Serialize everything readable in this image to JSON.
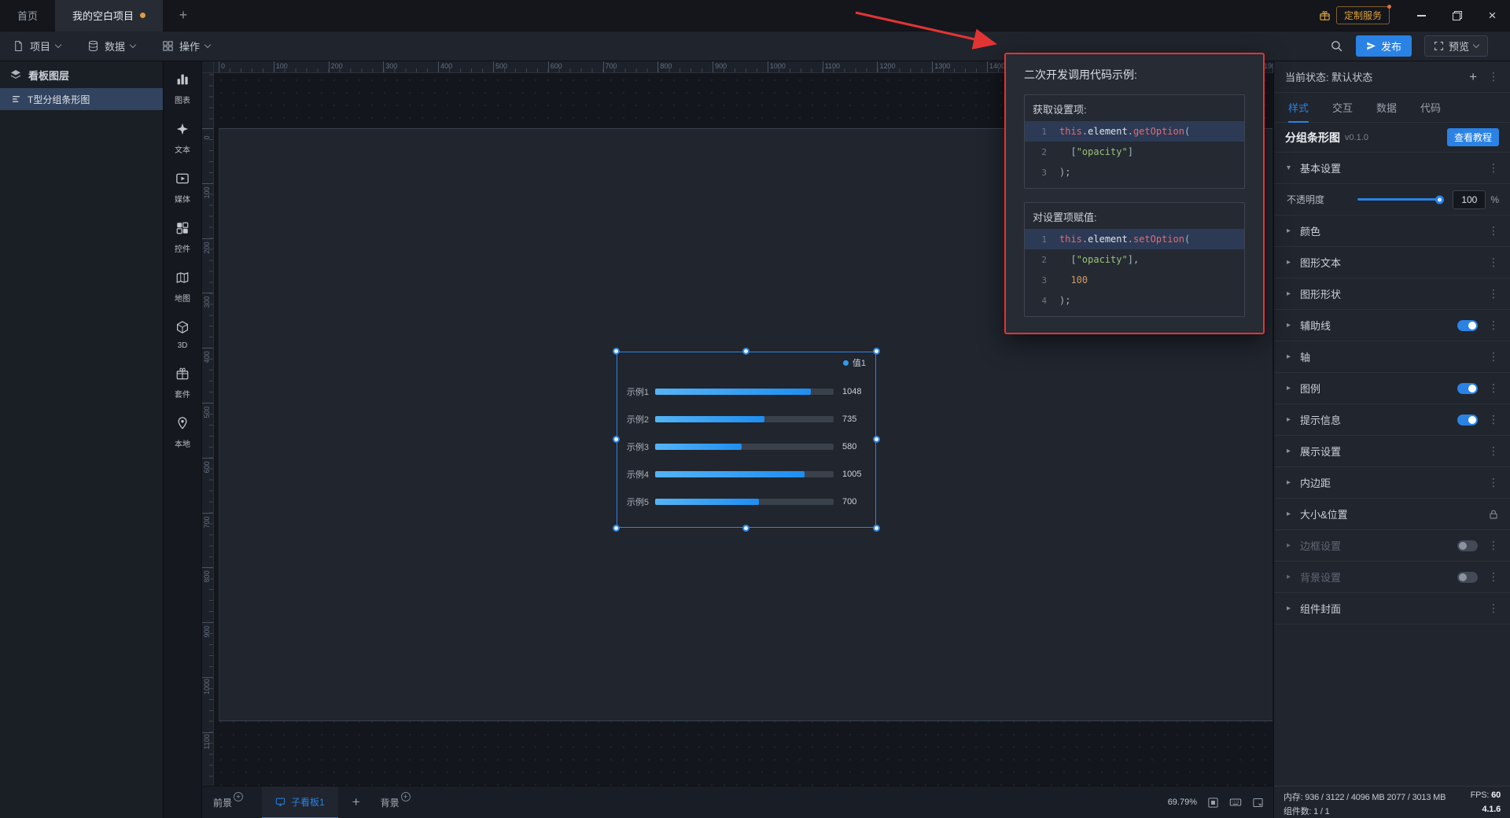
{
  "titlebar": {
    "home_tab": "首页",
    "project_tab": "我的空白项目",
    "custom_service": "定制服务"
  },
  "menubar": {
    "project": "项目",
    "data": "数据",
    "operation": "操作",
    "publish": "发布",
    "preview": "预览"
  },
  "layers_panel": {
    "title": "看板图层",
    "items": [
      {
        "label": "T型分组条形图",
        "selected": true
      }
    ]
  },
  "component_bar": {
    "items": [
      {
        "label": "图表",
        "icon": "chart-icon"
      },
      {
        "label": "文本",
        "icon": "text-icon"
      },
      {
        "label": "媒体",
        "icon": "media-icon"
      },
      {
        "label": "控件",
        "icon": "widget-icon"
      },
      {
        "label": "地图",
        "icon": "map-icon"
      },
      {
        "label": "3D",
        "icon": "cube-icon"
      },
      {
        "label": "套件",
        "icon": "kit-icon"
      },
      {
        "label": "本地",
        "icon": "pin-icon"
      }
    ]
  },
  "canvas": {
    "zoom_value": 69.79,
    "ruler_top": {
      "start": 0,
      "step": 100,
      "count": 20
    },
    "ruler_left": {
      "start": 0,
      "step": 100,
      "count": 12
    }
  },
  "chart_data": {
    "type": "bar",
    "orientation": "horizontal",
    "categories": [
      "示例1",
      "示例2",
      "示例3",
      "示例4",
      "示例5"
    ],
    "series": [
      {
        "name": "值1",
        "values": [
          1048,
          735,
          580,
          1005,
          700
        ]
      }
    ],
    "xlim": [
      0,
      1200
    ],
    "legend_position": "top-right",
    "bar_color": "#2d9cf0",
    "track_color": "#3b414b"
  },
  "popup": {
    "title": "二次开发调用代码示例:",
    "blocks": [
      {
        "label": "获取设置项:",
        "lines": [
          {
            "num": "1",
            "highlight": true,
            "tokens": [
              [
                "this",
                "kw"
              ],
              [
                ".",
                "pn"
              ],
              [
                "element",
                "id"
              ],
              [
                ".",
                "pn"
              ],
              [
                "getOption",
                "kw"
              ],
              [
                "(",
                "pn"
              ]
            ]
          },
          {
            "num": "2",
            "tokens": [
              [
                "  [",
                "pn"
              ],
              [
                "\"opacity\"",
                "str"
              ],
              [
                "]",
                "pn"
              ]
            ]
          },
          {
            "num": "3",
            "tokens": [
              [
                ");",
                "pn"
              ]
            ]
          }
        ]
      },
      {
        "label": "对设置项赋值:",
        "lines": [
          {
            "num": "1",
            "highlight": true,
            "tokens": [
              [
                "this",
                "kw"
              ],
              [
                ".",
                "pn"
              ],
              [
                "element",
                "id"
              ],
              [
                ".",
                "pn"
              ],
              [
                "setOption",
                "kw"
              ],
              [
                "(",
                "pn"
              ]
            ]
          },
          {
            "num": "2",
            "tokens": [
              [
                "  [",
                "pn"
              ],
              [
                "\"opacity\"",
                "str"
              ],
              [
                "],",
                "pn"
              ]
            ]
          },
          {
            "num": "3",
            "tokens": [
              [
                "  ",
                "pn"
              ],
              [
                "100",
                "num"
              ]
            ]
          },
          {
            "num": "4",
            "tokens": [
              [
                ");",
                "pn"
              ]
            ]
          }
        ]
      }
    ]
  },
  "right_panel": {
    "state_label": "当前状态: 默认状态",
    "tabs": [
      {
        "label": "样式",
        "active": true
      },
      {
        "label": "交互"
      },
      {
        "label": "数据"
      },
      {
        "label": "代码"
      }
    ],
    "component_title": "分组条形图",
    "component_version": "v0.1.0",
    "tutorial_button": "查看教程",
    "opacity": {
      "label": "不透明度",
      "value": "100",
      "unit": "%"
    },
    "sections": [
      {
        "label": "基本设置",
        "expanded": true,
        "dots": true
      },
      {
        "label": "颜色",
        "dots": true
      },
      {
        "label": "图形文本",
        "dots": true
      },
      {
        "label": "图形形状",
        "dots": true
      },
      {
        "label": "辅助线",
        "toggle": "on",
        "dots": true
      },
      {
        "label": "轴",
        "dots": true
      },
      {
        "label": "图例",
        "toggle": "on",
        "dots": true
      },
      {
        "label": "提示信息",
        "toggle": "on",
        "dots": true
      },
      {
        "label": "展示设置",
        "dots": true
      },
      {
        "label": "内边距",
        "dots": true
      },
      {
        "label": "大小&位置",
        "lock": true
      },
      {
        "label": "边框设置",
        "toggle": "off",
        "dimmed": true,
        "dots": true
      },
      {
        "label": "背景设置",
        "toggle": "off",
        "dimmed": true,
        "dots": true
      },
      {
        "label": "组件封面",
        "dots": true
      }
    ]
  },
  "bottom_bar": {
    "foreground_label": "前景",
    "board_tab": "子看板1",
    "background_label": "背景",
    "zoom": "69.79%"
  },
  "status_bar": {
    "memory": "内存: 936 / 3122 / 4096 MB 2077 / 3013 MB",
    "fps_label": "FPS:",
    "fps_value": "60",
    "component_count": "组件数: 1 / 1",
    "app_version": "4.1.6"
  },
  "glyphs": {
    "plus": "+",
    "dots": "⋮",
    "close": "×",
    "arrow_down": "▾",
    "arrow_right": "▸"
  }
}
